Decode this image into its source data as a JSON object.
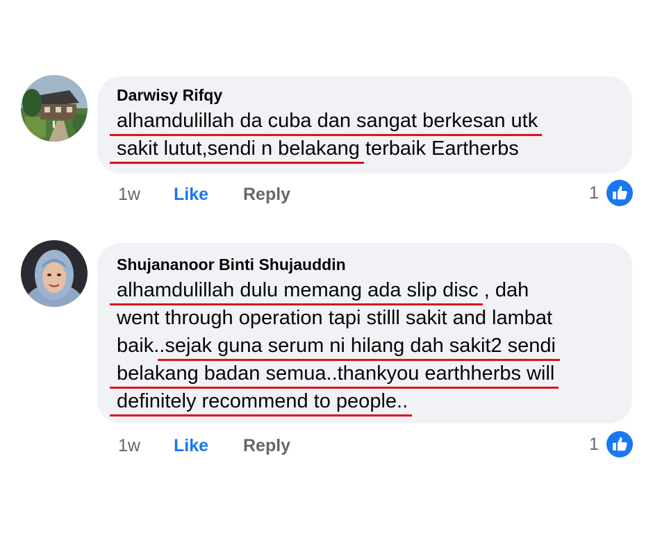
{
  "comments": [
    {
      "author": "Darwisy Rifqy",
      "lines": [
        {
          "segments": [
            {
              "text": "alhamdulillah da cuba dan sangat berkesan utk",
              "underline": true
            }
          ]
        },
        {
          "segments": [
            {
              "text": "sakit lutut,sendi n belakang",
              "underline": true
            },
            {
              "text": " terbaik Eartherbs",
              "underline": false
            }
          ]
        }
      ],
      "time": "1w",
      "like_label": "Like",
      "reply_label": "Reply",
      "reaction_count": "1",
      "reaction_icon": "thumbs-up-icon",
      "avatar_icon": "house-landscape-avatar"
    },
    {
      "author": "Shujananoor Binti Shujauddin",
      "lines": [
        {
          "segments": [
            {
              "text": "alhamdulillah dulu memang ada slip disc",
              "underline": true
            },
            {
              "text": " , dah",
              "underline": false
            }
          ]
        },
        {
          "segments": [
            {
              "text": "went through operation tapi stilll sakit and lambat",
              "underline": false
            }
          ]
        },
        {
          "segments": [
            {
              "text": "baik..",
              "underline": false
            },
            {
              "text": "sejak guna serum ni hilang dah sakit2 sendi",
              "underline": true
            }
          ]
        },
        {
          "segments": [
            {
              "text": "belakang badan semua..thankyou earthherbs will",
              "underline": true
            }
          ]
        },
        {
          "segments": [
            {
              "text": "definitely recommend to people..",
              "underline": true
            }
          ]
        }
      ],
      "time": "1w",
      "like_label": "Like",
      "reply_label": "Reply",
      "reaction_count": "1",
      "reaction_icon": "thumbs-up-icon",
      "avatar_icon": "woman-hijab-avatar"
    }
  ],
  "colors": {
    "bubble": "#f0f2f5",
    "like_blue": "#1877f2",
    "meta_gray": "#65676b",
    "underline_red": "#e0101a"
  }
}
